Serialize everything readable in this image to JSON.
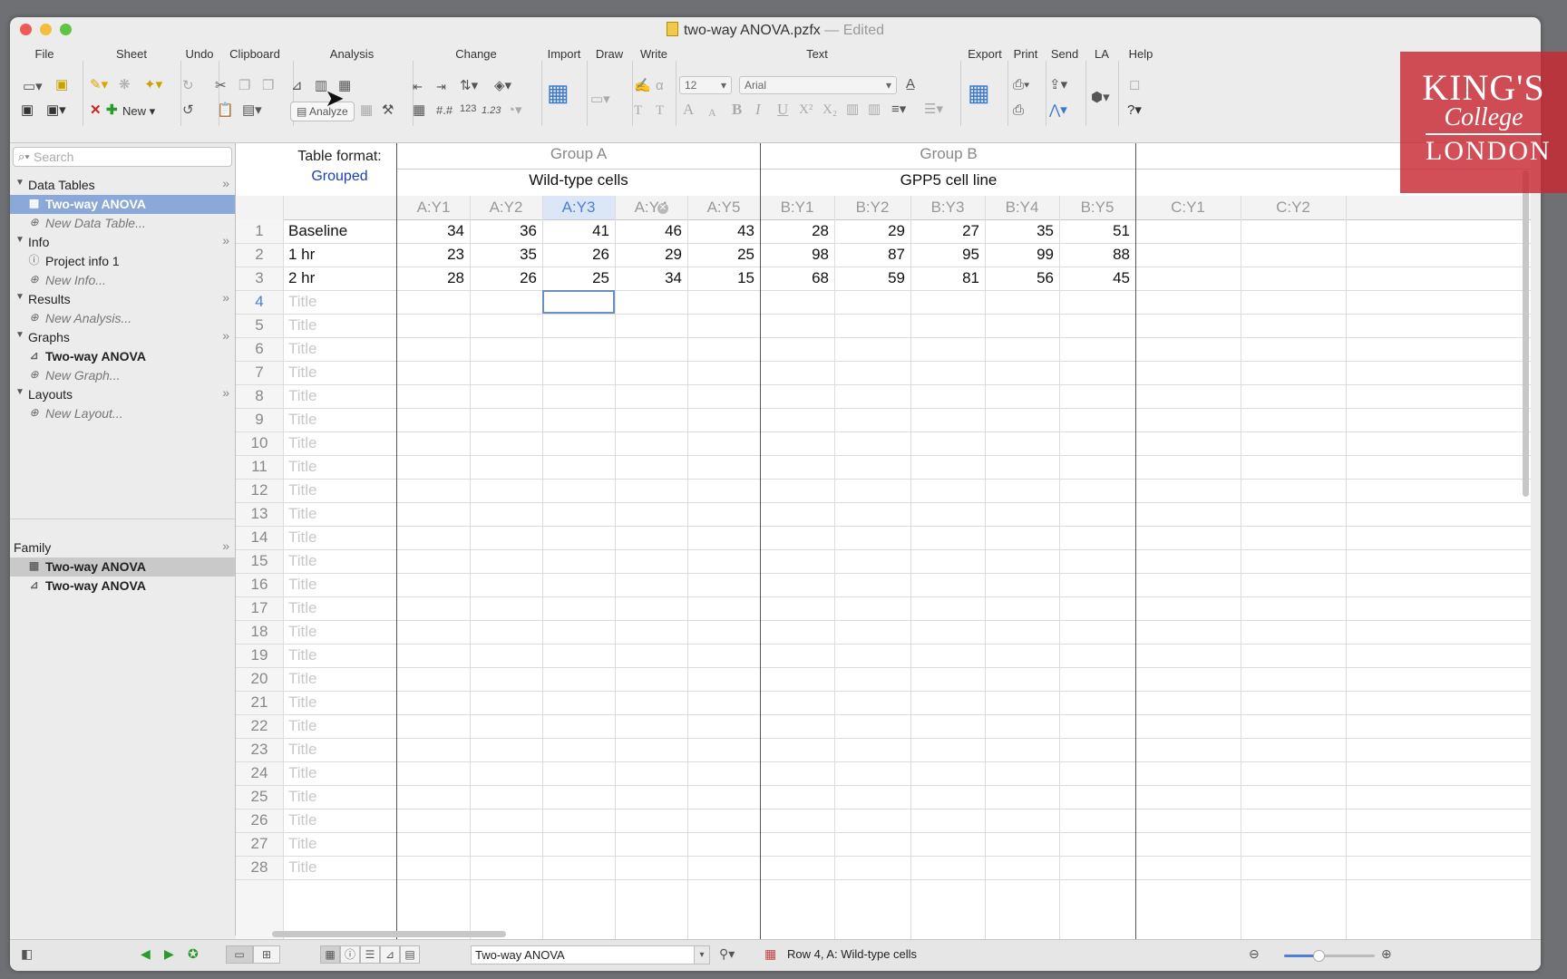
{
  "window": {
    "title": "two-way ANOVA.pzfx",
    "title_suffix": " — Edited"
  },
  "toolbar": {
    "groups": [
      "File",
      "Sheet",
      "Undo",
      "Clipboard",
      "Analysis",
      "Change",
      "Import",
      "Draw",
      "Write",
      "Text",
      "Export",
      "Print",
      "Send",
      "LA",
      "Help"
    ],
    "new_label": "New",
    "analyze_label": "Analyze",
    "font_size": "12",
    "font_name": "Arial"
  },
  "logo": {
    "line1": "KING'S",
    "line2": "College",
    "line3": "LONDON"
  },
  "sidebar": {
    "search_placeholder": "Search",
    "sections": {
      "data_tables": {
        "label": "Data Tables",
        "item": "Two-way ANOVA",
        "new": "New Data Table..."
      },
      "info": {
        "label": "Info",
        "item": "Project info 1",
        "new": "New Info..."
      },
      "results": {
        "label": "Results",
        "new": "New Analysis..."
      },
      "graphs": {
        "label": "Graphs",
        "item": "Two-way ANOVA",
        "new": "New Graph..."
      },
      "layouts": {
        "label": "Layouts",
        "new": "New Layout..."
      }
    },
    "family": {
      "label": "Family",
      "items": [
        "Two-way ANOVA",
        "Two-way ANOVA"
      ]
    },
    "more_glyph": "»"
  },
  "sheet": {
    "table_format_label": "Table format:",
    "table_format_value": "Grouped",
    "groups": [
      {
        "title": "Group A",
        "subtitle": "Wild-type cells"
      },
      {
        "title": "Group B",
        "subtitle": "GPP5 cell line"
      }
    ],
    "columns": [
      "A:Y1",
      "A:Y2",
      "A:Y3",
      "A:Y4",
      "A:Y5",
      "B:Y1",
      "B:Y2",
      "B:Y3",
      "B:Y4",
      "B:Y5",
      "C:Y1",
      "C:Y2"
    ],
    "rows": [
      {
        "num": "1",
        "title": "Baseline",
        "values": [
          "34",
          "36",
          "41",
          "46",
          "43",
          "28",
          "29",
          "27",
          "35",
          "51"
        ]
      },
      {
        "num": "2",
        "title": "1 hr",
        "values": [
          "23",
          "35",
          "26",
          "29",
          "25",
          "98",
          "87",
          "95",
          "99",
          "88"
        ]
      },
      {
        "num": "3",
        "title": "2 hr",
        "values": [
          "28",
          "26",
          "25",
          "34",
          "15",
          "68",
          "59",
          "81",
          "56",
          "45"
        ]
      }
    ],
    "placeholder_title": "Title",
    "empty_rows": [
      "4",
      "5",
      "6",
      "7",
      "8",
      "9",
      "10",
      "11",
      "12",
      "13",
      "14",
      "15",
      "16",
      "17",
      "18",
      "19",
      "20",
      "21",
      "22",
      "23",
      "24",
      "25",
      "26",
      "27",
      "28"
    ],
    "active_row": "4",
    "active_column": "A:Y3"
  },
  "statusbar": {
    "sheet_name": "Two-way ANOVA",
    "status": "Row 4, A: Wild-type cells",
    "zoom_fraction": 0.38
  }
}
